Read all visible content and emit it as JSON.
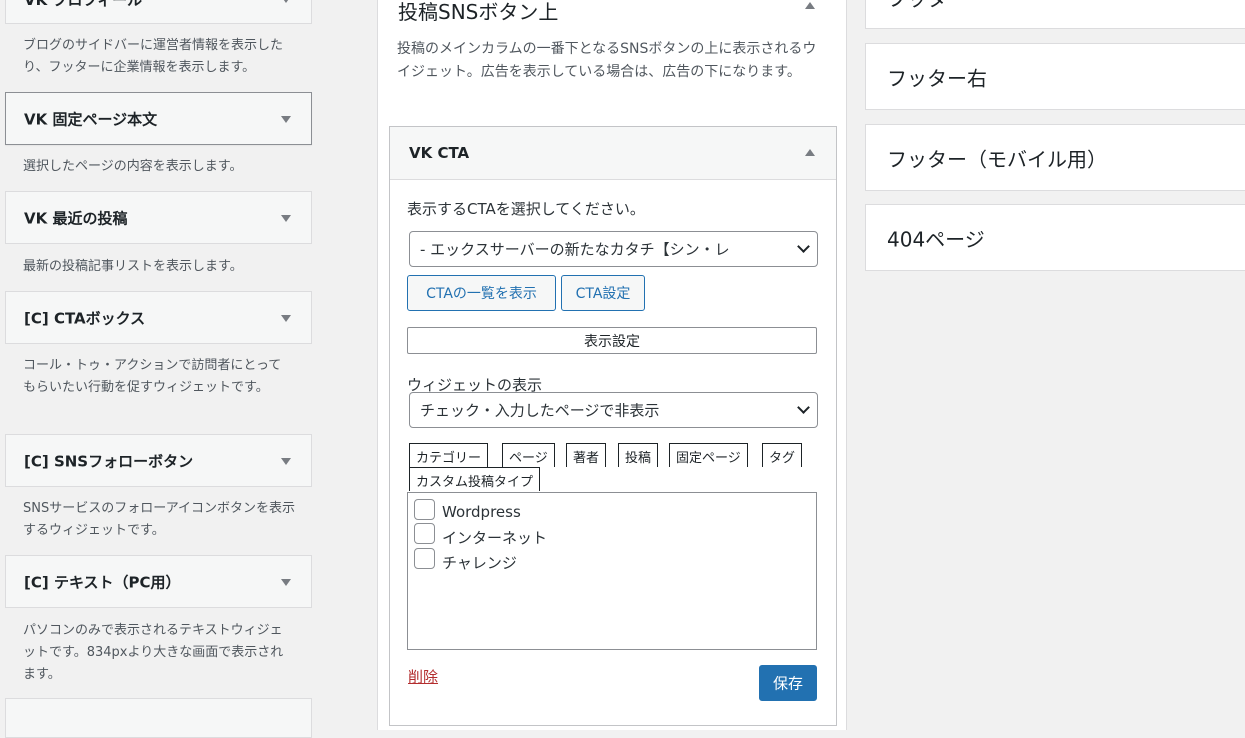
{
  "left_widgets": [
    {
      "title": "VK プロフィール",
      "desc": "ブログのサイドバーに運営者情報を表示したり、フッターに企業情報を表示します。"
    },
    {
      "title": "VK 固定ページ本文",
      "desc": "選択したページの内容を表示します。"
    },
    {
      "title": "VK 最近の投稿",
      "desc": "最新の投稿記事リストを表示します。"
    },
    {
      "title": "[C] CTAボックス",
      "desc": "コール・トゥ・アクションで訪問者にとってもらいたい行動を促すウィジェットです。"
    },
    {
      "title": "[C] SNSフォローボタン",
      "desc": "SNSサービスのフォローアイコンボタンを表示するウィジェットです。"
    },
    {
      "title": "[C] テキスト（PC用）",
      "desc": "パソコンのみで表示されるテキストウィジェットです。834pxより大きな画面で表示されます。"
    }
  ],
  "sidebar": {
    "title": "投稿SNSボタン上",
    "desc": "投稿のメインカラムの一番下となるSNSボタンの上に表示されるウイジェット。広告を表示している場合は、広告の下になります。"
  },
  "cta_widget": {
    "title": "VK CTA",
    "select_label": "表示するCTAを選択してください。",
    "select_value": "- エックスサーバーの新たなカタチ【シン・レ",
    "btn_list": "CTAの一覧を表示",
    "btn_settings": "CTA設定",
    "display_settings": "表示設定",
    "widget_display_label": "ウィジェットの表示",
    "widget_display_value": "チェック・入力したページで非表示",
    "tabs": [
      "カテゴリー",
      "ページ",
      "著者",
      "投稿",
      "固定ページ",
      "タグ",
      "カスタム投稿タイプ"
    ],
    "checkboxes": [
      "Wordpress",
      "インターネット",
      "チャレンジ"
    ],
    "delete": "削除",
    "save": "保存"
  },
  "right_areas": [
    "フッター",
    "フッター右",
    "フッター（モバイル用）",
    "404ページ"
  ],
  "colors": {
    "accent": "#2271b1",
    "danger": "#b32d2e",
    "bg": "#f1f1f1"
  }
}
